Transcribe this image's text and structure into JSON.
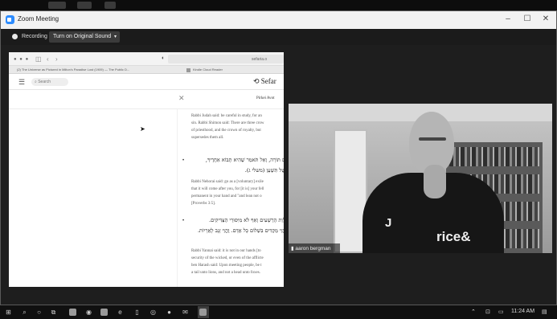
{
  "window": {
    "title": "Zoom Meeting",
    "minimize": "–",
    "maximize": "☐",
    "close": "✕"
  },
  "toolbar": {
    "recording": "Recording",
    "sound_button": "Turn on Original Sound",
    "caret": "▾"
  },
  "browser": {
    "nav_back": "‹",
    "nav_fwd": "›",
    "url": "sefaria.o",
    "tabs": [
      "(2) The Universe as Pictured in Milton's Paradise Lost (1909) — The Public D...",
      "Kindle Cloud Reader"
    ]
  },
  "sefaria": {
    "search_placeholder": "Search",
    "brand": "Sefar",
    "section_title": "Pirkei Avot",
    "close": "✕",
    "paragraphs": [
      [
        "Rabbi Judah said: be careful in study, for an",
        "sin. Rabbi Shimon said: There are three crow",
        "of priesthood, and the crown of royalty, but",
        "supersedes them all."
      ],
      [
        "Rabbi Nehorai said: go as a [voluntary] exile",
        "that it will come after you, for [it is] your fell",
        "permanent in your hand and \"and lean not o",
        "[Proverbs 3:5]."
      ],
      [
        "Rabbi Yannai said: it is not in our hands [to",
        "security of the wicked, or even of the afflicte",
        "ben Harash said: Upon meeting people, be t",
        "a tail unto lions, and not a head unto foxes."
      ]
    ],
    "hebrew": [
      [
        "ם תּוֹרָה, וְאַל תֹּאמַר שֶׁהִיא תָבוֹא אַחֲרֶיךָ,",
        "שֶׁל תִּשְׁעָן (משלי ג)."
      ],
      [
        "לְוַת הָרְשָׁעִים וְאַף לֹא מִיִּסּוּרֵי הַצַּדִּיקִים.",
        "הֱוֵי מַקְדִּים בִּשְׁלוֹם כָּל אָדָם. וֶהֱוֵי זָנָב לָאֲרָיוֹת."
      ]
    ],
    "bullet": "•"
  },
  "video": {
    "participant_name": "aaron bergman",
    "shirt_text_1": "J",
    "shirt_text_2": "rice&"
  },
  "taskbar": {
    "time": "11:24 AM"
  }
}
